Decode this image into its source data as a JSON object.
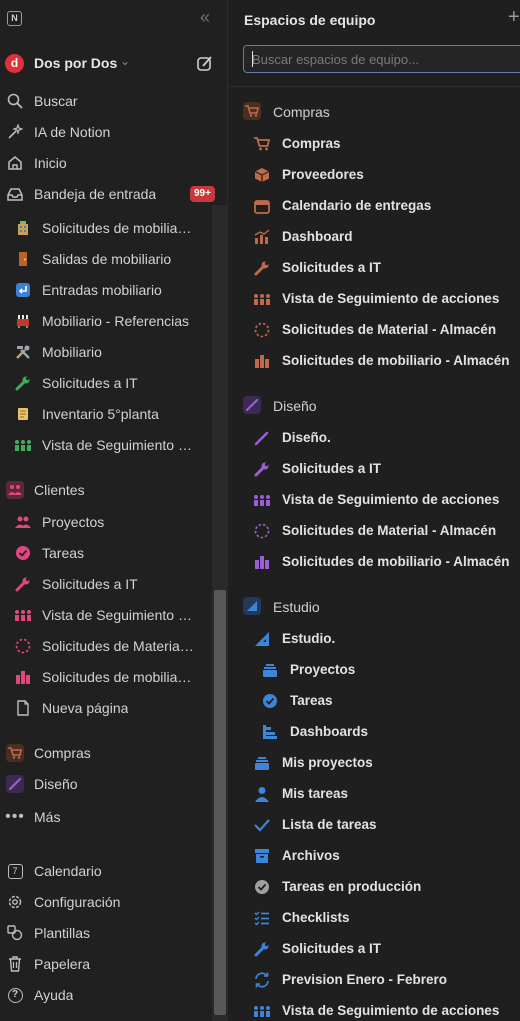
{
  "sidebar": {
    "workspace": {
      "name": "Dos por Dos",
      "avatar_letter": "d"
    },
    "top_items": [
      {
        "label": "Buscar",
        "icon": "search-icon"
      },
      {
        "label": "IA de Notion",
        "icon": "ai-sparkle-icon"
      },
      {
        "label": "Inicio",
        "icon": "home-icon"
      },
      {
        "label": "Bandeja de entrada",
        "icon": "inbox-icon",
        "badge": "99+"
      }
    ],
    "pages": [
      {
        "label": "Solicitudes de mobiliario - Almacén",
        "icon": "office-building-icon"
      },
      {
        "label": "Salidas de mobiliario",
        "icon": "door-icon"
      },
      {
        "label": "Entradas mobiliario",
        "icon": "return-arrow-icon"
      },
      {
        "label": "Mobiliario - Referencias",
        "icon": "furniture-icon"
      },
      {
        "label": "Mobiliario",
        "icon": "tools-icon"
      },
      {
        "label": "Solicitudes a IT",
        "icon": "wrench-icon"
      },
      {
        "label": "Inventario 5°planta",
        "icon": "scroll-icon"
      },
      {
        "label": "Vista de Seguimiento de acciones",
        "icon": "people-icon"
      }
    ],
    "clientes": {
      "label": "Clientes",
      "items": [
        {
          "label": "Proyectos",
          "icon": "people-icon"
        },
        {
          "label": "Tareas",
          "icon": "check-circle-icon"
        },
        {
          "label": "Solicitudes a IT",
          "icon": "wrench-icon"
        },
        {
          "label": "Vista de Seguimiento de acciones",
          "icon": "group-icon"
        },
        {
          "label": "Solicitudes de Material - Almacén",
          "icon": "dashed-circle-icon"
        },
        {
          "label": "Solicitudes de mobiliario - Almacén",
          "icon": "building-icon"
        },
        {
          "label": "Nueva página",
          "icon": "page-icon"
        }
      ]
    },
    "spaces": [
      {
        "label": "Compras",
        "icon": "cart-icon"
      },
      {
        "label": "Diseño",
        "icon": "brush-icon"
      },
      {
        "label": "Más",
        "icon": "more-icon"
      }
    ],
    "bottom_items": [
      {
        "label": "Calendario",
        "icon": "calendar-icon",
        "icon_text": "7"
      },
      {
        "label": "Configuración",
        "icon": "gear-icon"
      },
      {
        "label": "Plantillas",
        "icon": "templates-icon"
      },
      {
        "label": "Papelera",
        "icon": "trash-icon"
      },
      {
        "label": "Ayuda",
        "icon": "help-icon"
      }
    ]
  },
  "panel": {
    "title": "Espacios de equipo",
    "plus": "+",
    "search_placeholder": "Buscar espacios de equipo...",
    "sections": [
      {
        "label": "Compras",
        "color": "#c06a4a",
        "items": [
          {
            "label": "Compras",
            "icon": "cart-icon"
          },
          {
            "label": "Proveedores",
            "icon": "box-icon"
          },
          {
            "label": "Calendario de entregas",
            "icon": "calendar-icon"
          },
          {
            "label": "Dashboard",
            "icon": "chart-icon"
          },
          {
            "label": "Solicitudes a IT",
            "icon": "wrench-icon"
          },
          {
            "label": "Vista de Seguimiento de acciones",
            "icon": "group-icon"
          },
          {
            "label": "Solicitudes de Material - Almacén",
            "icon": "dashed-circle-icon"
          },
          {
            "label": "Solicitudes de mobiliario - Almacén",
            "icon": "building-icon"
          }
        ]
      },
      {
        "label": "Diseño",
        "color": "#9a5fd4",
        "items": [
          {
            "label": "Diseño.",
            "icon": "brush-icon"
          },
          {
            "label": "Solicitudes a IT",
            "icon": "wrench-icon"
          },
          {
            "label": "Vista de Seguimiento de acciones",
            "icon": "group-icon"
          },
          {
            "label": "Solicitudes de Material - Almacén",
            "icon": "dashed-circle-icon"
          },
          {
            "label": "Solicitudes de mobiliario - Almacén",
            "icon": "building-icon"
          }
        ]
      },
      {
        "label": "Estudio",
        "color": "#3e84d8",
        "items": [
          {
            "label": "Estudio.",
            "icon": "ruler-triangle-icon"
          },
          {
            "label": "Proyectos",
            "icon": "stack-icon",
            "sub": true
          },
          {
            "label": "Tareas",
            "icon": "check-circle-icon",
            "sub": true
          },
          {
            "label": "Dashboards",
            "icon": "gantt-icon",
            "sub": true
          },
          {
            "label": "Mis proyectos",
            "icon": "stack-icon"
          },
          {
            "label": "Mis tareas",
            "icon": "person-icon"
          },
          {
            "label": "Lista de tareas",
            "icon": "checkmark-icon"
          },
          {
            "label": "Archivos",
            "icon": "archive-icon"
          },
          {
            "label": "Tareas en producción",
            "icon": "check-circle-icon"
          },
          {
            "label": "Checklists",
            "icon": "checklist-icon"
          },
          {
            "label": "Solicitudes a IT",
            "icon": "wrench-icon"
          },
          {
            "label": "Prevision Enero - Febrero",
            "icon": "refresh-icon"
          },
          {
            "label": "Vista de Seguimiento de acciones",
            "icon": "group-icon"
          }
        ]
      }
    ]
  }
}
